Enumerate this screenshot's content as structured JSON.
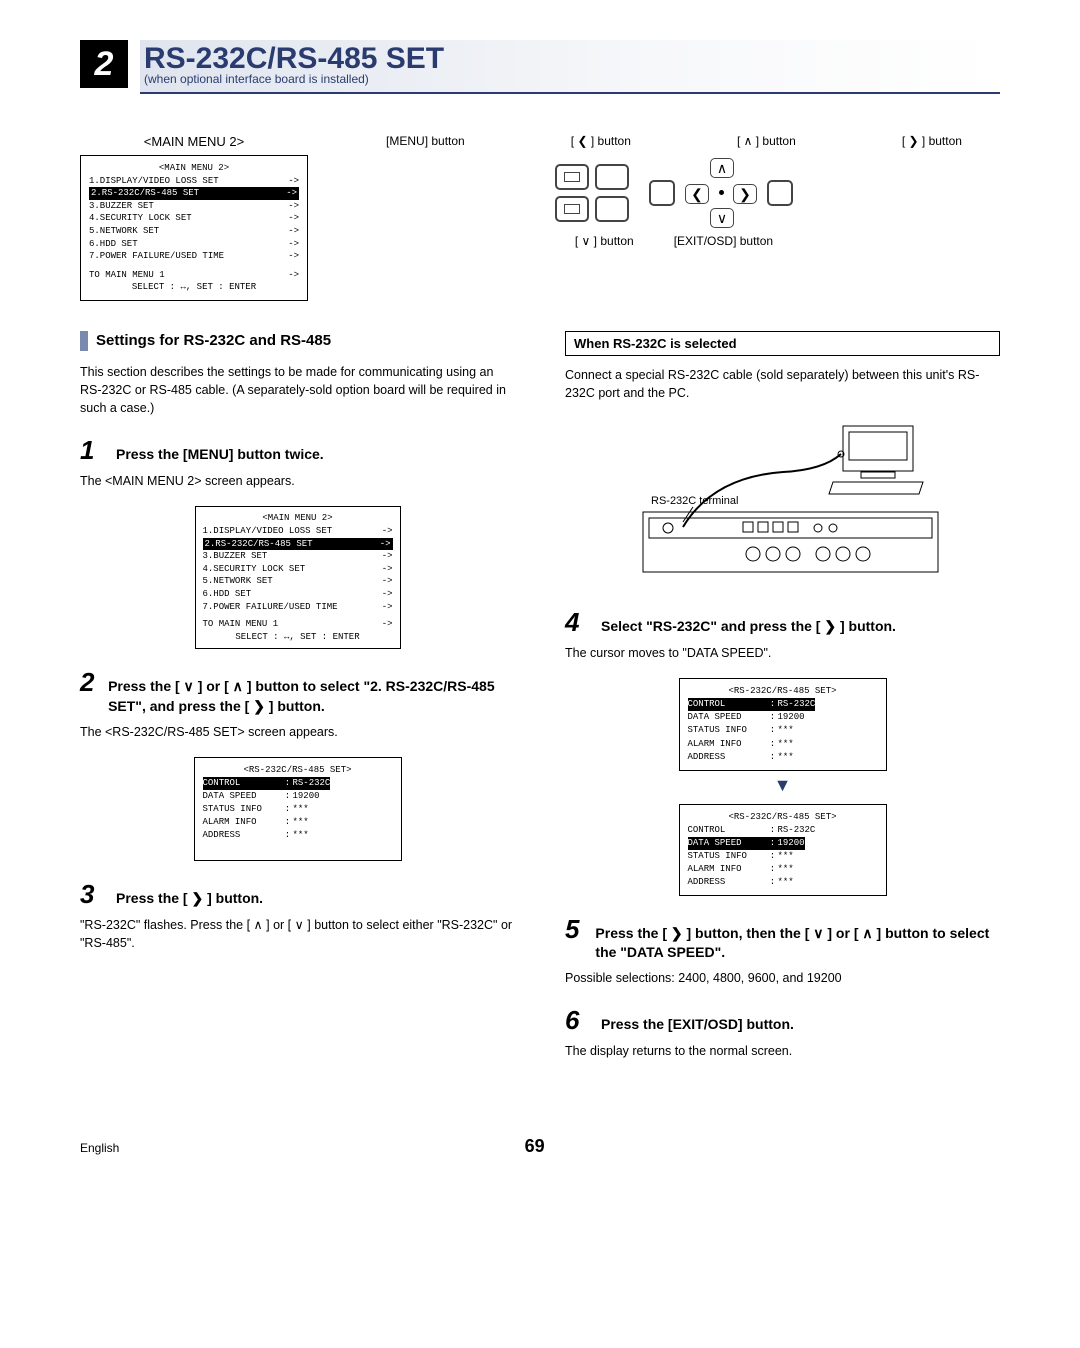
{
  "header": {
    "section_number": "2",
    "title": "RS-232C/RS-485 SET",
    "subtitle": "(when optional interface board is installed)"
  },
  "top": {
    "menu_title": "<MAIN MENU 2>",
    "buttons": {
      "menu": "[MENU] button",
      "left": "[ ❮ ] button",
      "up": "[ ❯ ] button",
      "right_btn": "[ ❯ ] button",
      "up_btn": "[ ❮ ] button",
      "down_lbl": "[ ❯ ] button",
      "exit_lbl": "[EXIT/OSD] button"
    },
    "labelrow": [
      "[MENU] button",
      "[ ❮ ] button",
      "[ ∧ ] button",
      "[ ❯ ] button"
    ],
    "under": [
      "[ ∨ ] button",
      "[EXIT/OSD] button"
    ]
  },
  "main_menu2": {
    "title": "<MAIN MENU 2>",
    "items": [
      {
        "l": "1.DISPLAY/VIDEO LOSS SET",
        "r": "->"
      },
      {
        "l": "2.RS-232C/RS-485 SET",
        "r": "->",
        "hl": true
      },
      {
        "l": "3.BUZZER SET",
        "r": "->"
      },
      {
        "l": "4.SECURITY LOCK SET",
        "r": "->"
      },
      {
        "l": "5.NETWORK SET",
        "r": "->"
      },
      {
        "l": "6.HDD SET",
        "r": "->"
      },
      {
        "l": "7.POWER FAILURE/USED TIME",
        "r": "->"
      }
    ],
    "back": "TO MAIN MENU 1",
    "back_r": "->",
    "foot": "SELECT : ↔,   SET : ENTER"
  },
  "left": {
    "section_title": "Settings for RS-232C and RS-485",
    "intro": "This section describes the settings to be made for communicating using an RS-232C or RS-485 cable. (A separately-sold option board will be required in such a case.)",
    "step1_head": "Press the [MENU] button twice.",
    "step1_body": "The <MAIN MENU 2> screen appears.",
    "step2_head": "Press the [ ∨ ] or [ ∧ ] button to select \"2. RS-232C/RS-485 SET\", and press the [ ❯ ] button.",
    "step2_body": "The <RS-232C/RS-485 SET> screen appears.",
    "step3_head": "Press the [ ❯ ] button.",
    "step3_body": "\"RS-232C\" flashes. Press the [ ∧ ] or [ ∨ ] button to select either \"RS-232C\" or \"RS-485\"."
  },
  "rs_set_box": {
    "title": "<RS-232C/RS-485 SET>",
    "rows": [
      {
        "lab": "CONTROL",
        "val": "RS-232C",
        "hl": true
      },
      {
        "lab": "DATA SPEED",
        "val": "19200"
      },
      {
        "lab": "STATUS INFO",
        "val": "***"
      },
      {
        "lab": "ALARM INFO",
        "val": "***"
      },
      {
        "lab": "ADDRESS",
        "val": "***"
      }
    ]
  },
  "right": {
    "sub_boxed": "When RS-232C is selected",
    "connect_text": "Connect a special RS-232C cable (sold separately) between this unit's RS-232C port and the PC.",
    "terminal_label": "RS-232C terminal",
    "step4_head": "Select \"RS-232C\" and press the [ ❯ ] button.",
    "step4_body": "The cursor moves to \"DATA SPEED\".",
    "step5_head": "Press the [ ❯ ] button, then the [ ∨ ] or [ ∧ ] button to select the \"DATA SPEED\".",
    "step5_body": "Possible selections: 2400, 4800, 9600, and 19200",
    "step6_head": "Press the [EXIT/OSD] button.",
    "step6_body": "The display returns to the normal screen."
  },
  "rs_set_box_b": {
    "title": "<RS-232C/RS-485 SET>",
    "rows": [
      {
        "lab": "CONTROL",
        "val": "RS-232C"
      },
      {
        "lab": "DATA SPEED",
        "val": "19200",
        "hl": true
      },
      {
        "lab": "STATUS INFO",
        "val": "***"
      },
      {
        "lab": "ALARM INFO",
        "val": "***"
      },
      {
        "lab": "ADDRESS",
        "val": "***"
      }
    ]
  },
  "footer": {
    "lang": "English",
    "page": "69"
  }
}
